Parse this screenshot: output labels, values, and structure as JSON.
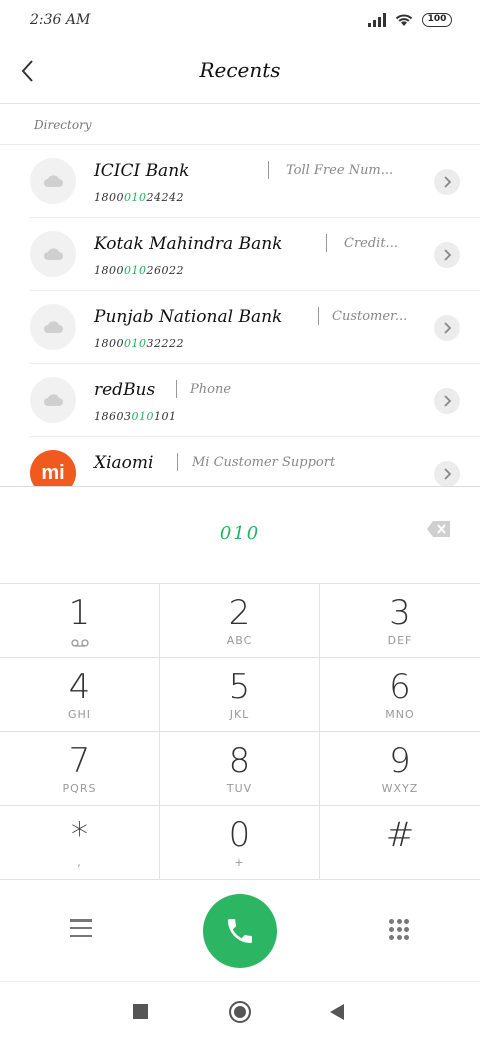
{
  "status_bar": {
    "time": "2:36 AM",
    "battery": "100"
  },
  "header": {
    "title": "Recents"
  },
  "section": {
    "label": "Directory"
  },
  "contacts": [
    {
      "name": "ICICI Bank",
      "description": "Toll Free Num...",
      "number_pre": "1800",
      "number_hl": "010",
      "number_post": "24242",
      "avatar": "cloud-icon"
    },
    {
      "name": "Kotak Mahindra Bank",
      "description": "Credit...",
      "number_pre": "1800",
      "number_hl": "010",
      "number_post": "26022",
      "avatar": "cloud-icon"
    },
    {
      "name": "Punjab National Bank",
      "description": "Customer...",
      "number_pre": "1800",
      "number_hl": "010",
      "number_post": "32222",
      "avatar": "cloud-icon"
    },
    {
      "name": "redBus",
      "description": "Phone",
      "number_pre": "18603",
      "number_hl": "010",
      "number_post": "101",
      "avatar": "cloud-icon"
    },
    {
      "name": "Xiaomi",
      "description": "Mi Customer Support",
      "number_pre": "",
      "number_hl": "",
      "number_post": "",
      "avatar": "mi-logo-icon",
      "avatar_text": "mi"
    }
  ],
  "dialer": {
    "number": "010"
  },
  "keys": [
    {
      "digit": "1",
      "letters": ""
    },
    {
      "digit": "2",
      "letters": "ABC"
    },
    {
      "digit": "3",
      "letters": "DEF"
    },
    {
      "digit": "4",
      "letters": "GHI"
    },
    {
      "digit": "5",
      "letters": "JKL"
    },
    {
      "digit": "6",
      "letters": "MNO"
    },
    {
      "digit": "7",
      "letters": "PQRS"
    },
    {
      "digit": "8",
      "letters": "TUV"
    },
    {
      "digit": "9",
      "letters": "WXYZ"
    },
    {
      "digit": "*",
      "letters": ","
    },
    {
      "digit": "0",
      "letters": "+"
    },
    {
      "digit": "#",
      "letters": ""
    }
  ],
  "colors": {
    "accent": "#2cb562",
    "highlight": "#22b35e",
    "mi_brand": "#f05a1e"
  }
}
